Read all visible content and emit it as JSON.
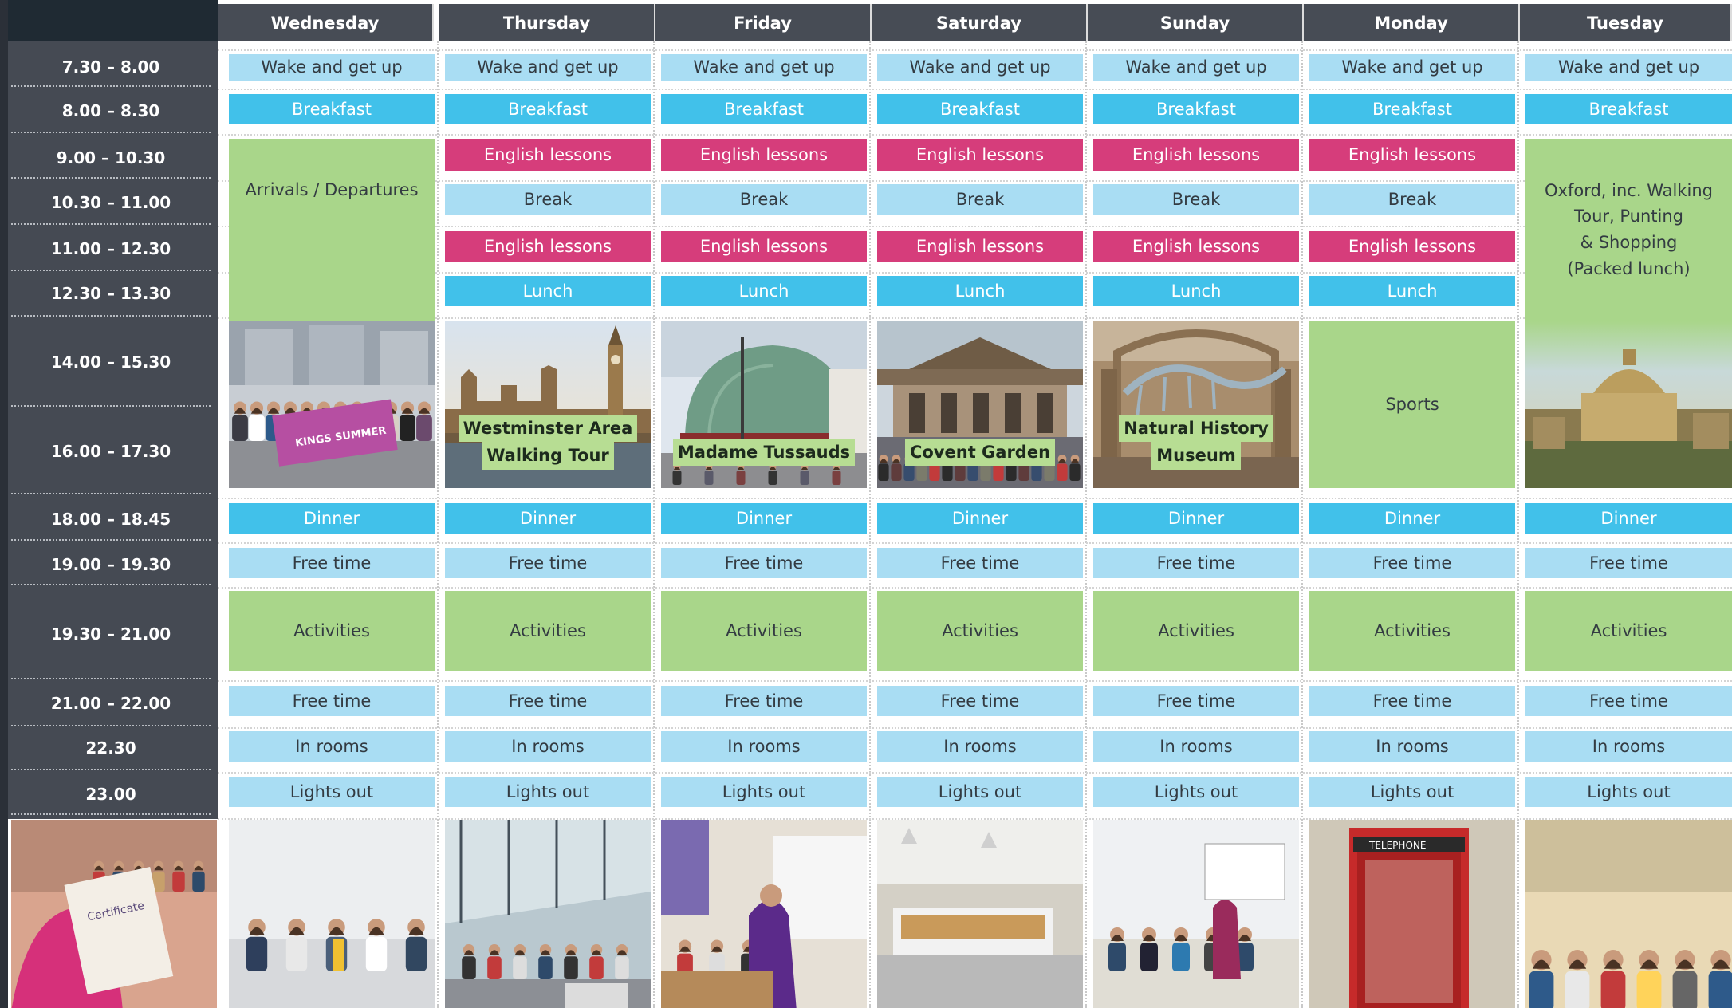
{
  "days": [
    "Wednesday",
    "Thursday",
    "Friday",
    "Saturday",
    "Sunday",
    "Monday",
    "Tuesday"
  ],
  "times": [
    "7.30 – 8.00",
    "8.00 – 8.30",
    "9.00 – 10.30",
    "10.30 – 11.00",
    "11.00 – 12.30",
    "12.30 – 13.30",
    "14.00 – 15.30",
    "16.00 – 17.30",
    "18.00 – 18.45",
    "19.00 – 19.30",
    "19.30 – 21.00",
    "21.00 – 22.00",
    "22.30",
    "23.00"
  ],
  "activities": {
    "wake": "Wake and get up",
    "breakfast": "Breakfast",
    "english": "English lessons",
    "break": "Break",
    "lunch": "Lunch",
    "dinner": "Dinner",
    "free_time": "Free time",
    "activities": "Activities",
    "in_rooms": "In rooms",
    "lights_out": "Lights out"
  },
  "special": {
    "arrivals": "Arrivals / Departures",
    "oxford_lines": [
      "Oxford, inc. Walking",
      "Tour, Punting",
      "& Shopping",
      "(Packed lunch)"
    ],
    "sports": "Sports"
  },
  "excursions": [
    {
      "lines": [
        "Westminster Area",
        "Walking Tour"
      ],
      "photo": "westminster-photo"
    },
    {
      "lines": [
        "Madame Tussauds"
      ],
      "photo": "madame-tussauds-photo"
    },
    {
      "lines": [
        "Covent Garden"
      ],
      "photo": "covent-garden-photo"
    },
    {
      "lines": [
        "Natural History",
        "Museum"
      ],
      "photo": "natural-history-museum-photo"
    }
  ],
  "photos": {
    "banner_text": "KINGS SUMMER",
    "certificate_text": "Certificate",
    "telephone_text": "TELEPHONE"
  },
  "colors": {
    "light_blue": "#a9ddf3",
    "blue": "#41c1ea",
    "pink": "#d63d7b",
    "green": "#a9d68a",
    "header_gray": "#474c55"
  }
}
